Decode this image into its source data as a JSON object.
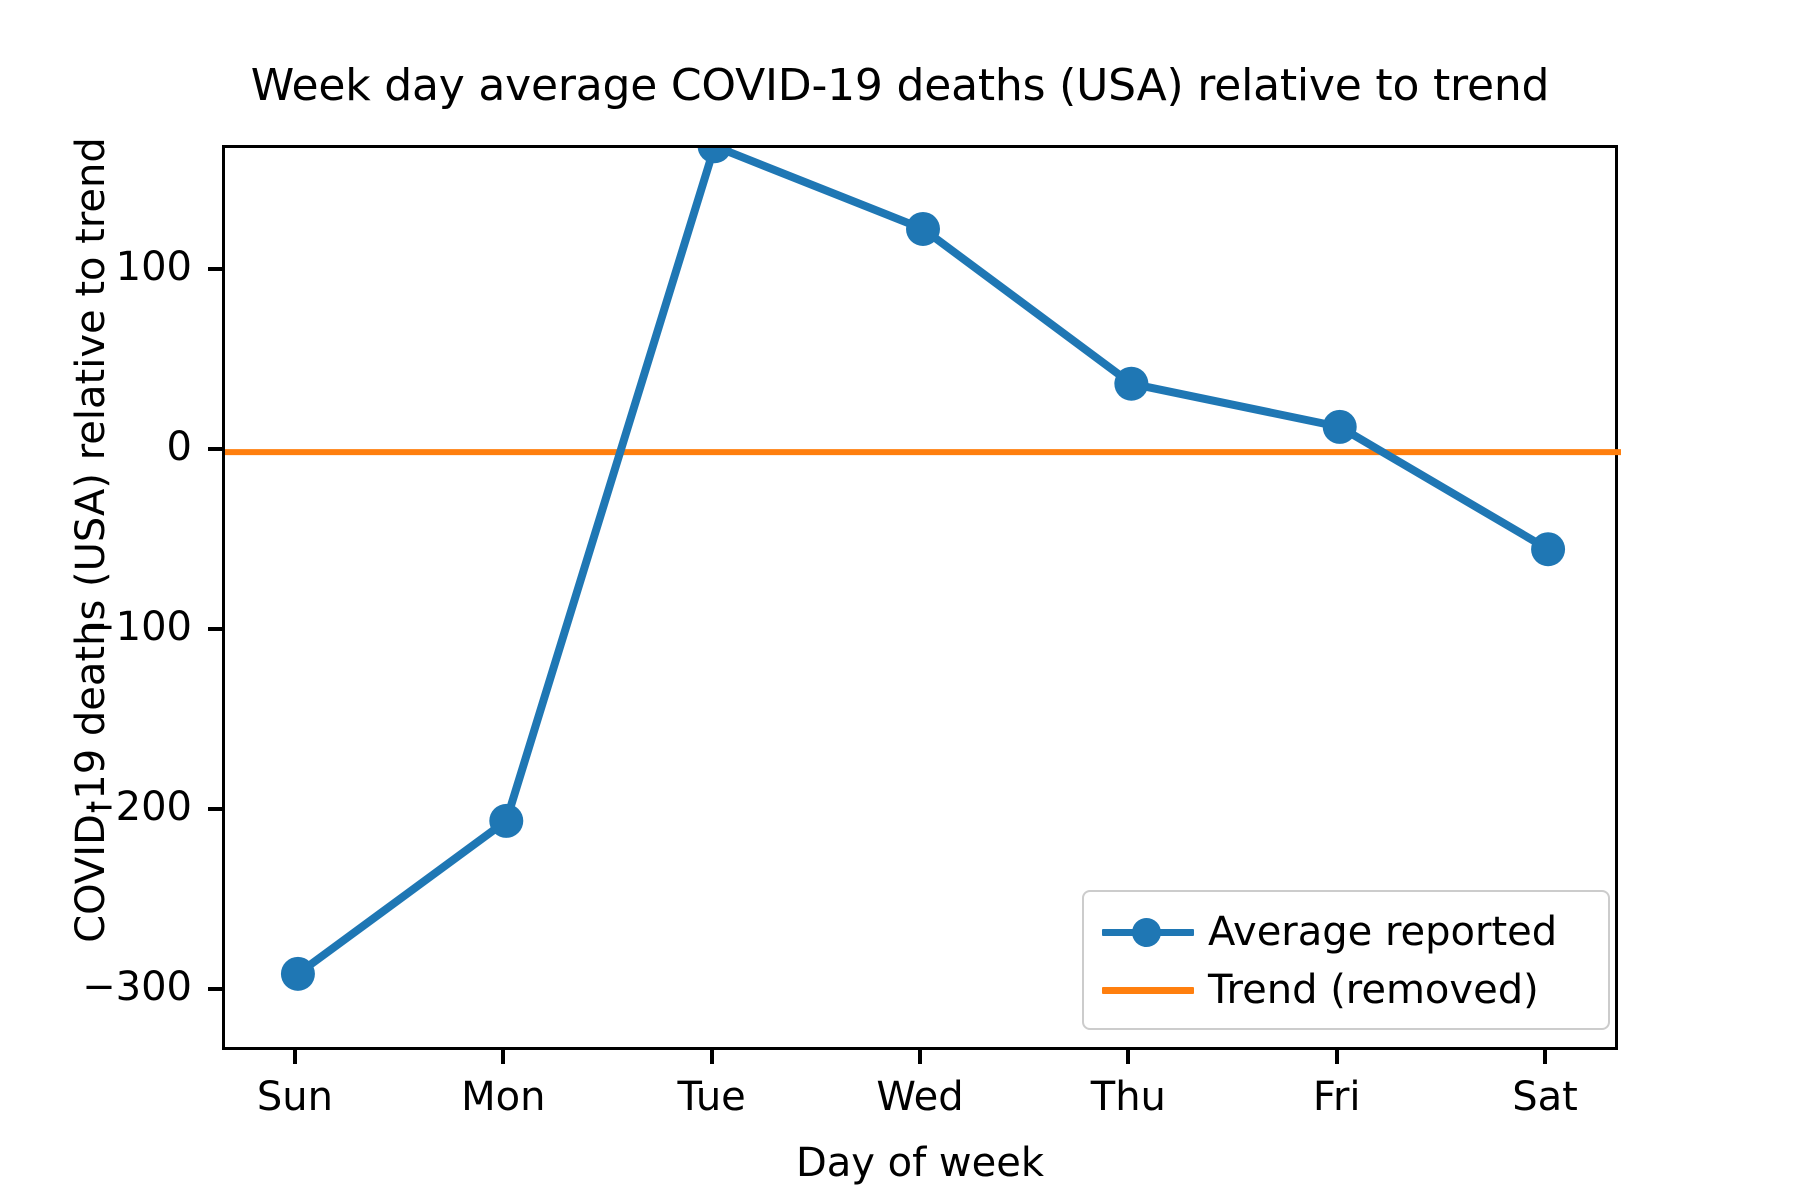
{
  "chart_data": {
    "type": "line",
    "title": "Week day average COVID-19 deaths (USA) relative to trend",
    "xlabel": "Day of week",
    "ylabel": "COVID-19 deaths (USA) relative to trend",
    "categories": [
      "Sun",
      "Mon",
      "Tue",
      "Wed",
      "Thu",
      "Fri",
      "Sat"
    ],
    "series": [
      {
        "name": "Average reported",
        "color": "#1f77b4",
        "marker": "circle",
        "values": [
          -290,
          -205,
          170,
          124,
          38,
          14,
          -54
        ]
      },
      {
        "name": "Trend (removed)",
        "color": "#ff7f0e",
        "marker": "none",
        "constant_value": 0,
        "values": [
          0,
          0,
          0,
          0,
          0,
          0,
          0
        ]
      }
    ],
    "ylim": [
      -334,
      169
    ],
    "xlim": [
      -0.35,
      6.35
    ],
    "yticks": [
      100,
      0,
      -100,
      -200,
      -300
    ],
    "ytick_labels": [
      "100",
      "0",
      "−100",
      "−200",
      "−300"
    ],
    "xtick_labels": [
      "Sun",
      "Mon",
      "Tue",
      "Wed",
      "Thu",
      "Fri",
      "Sat"
    ],
    "grid": false,
    "legend_position": "lower right",
    "legend_entries": [
      "Average reported",
      "Trend (removed)"
    ]
  },
  "legend": {
    "entries": [
      {
        "label": "Average reported"
      },
      {
        "label": "Trend (removed)"
      }
    ]
  },
  "axes": {
    "ytick_labels": [
      "100",
      "0",
      "−100",
      "−200",
      "−300"
    ],
    "xtick_labels": [
      "Sun",
      "Mon",
      "Tue",
      "Wed",
      "Thu",
      "Fri",
      "Sat"
    ]
  }
}
